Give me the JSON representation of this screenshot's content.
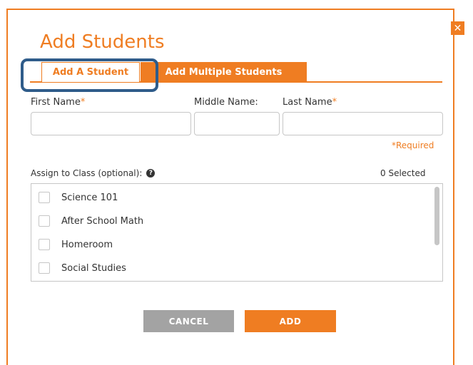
{
  "dialog": {
    "title": "Add Students",
    "close_icon": "close-icon"
  },
  "tabs": [
    {
      "label": "Add A Student",
      "active": true
    },
    {
      "label": "Add Multiple Students",
      "active": false
    }
  ],
  "form": {
    "first_name_label": "First Name",
    "middle_name_label": "Middle Name:",
    "last_name_label": "Last Name",
    "required_marker": "*",
    "required_note": "*Required",
    "first_name_value": "",
    "middle_name_value": "",
    "last_name_value": ""
  },
  "assign": {
    "label": "Assign to Class (optional):",
    "help_icon": "question-circle-icon",
    "selected_count": "0 Selected",
    "classes": [
      {
        "name": "Science 101",
        "checked": false
      },
      {
        "name": "After School Math",
        "checked": false
      },
      {
        "name": "Homeroom",
        "checked": false
      },
      {
        "name": "Social Studies",
        "checked": false
      }
    ]
  },
  "buttons": {
    "cancel": "CANCEL",
    "add": "ADD"
  },
  "colors": {
    "accent": "#ef7d22",
    "highlight": "#2f5c8a",
    "cancel_gray": "#a3a3a3",
    "border_gray": "#c6c6c6"
  }
}
